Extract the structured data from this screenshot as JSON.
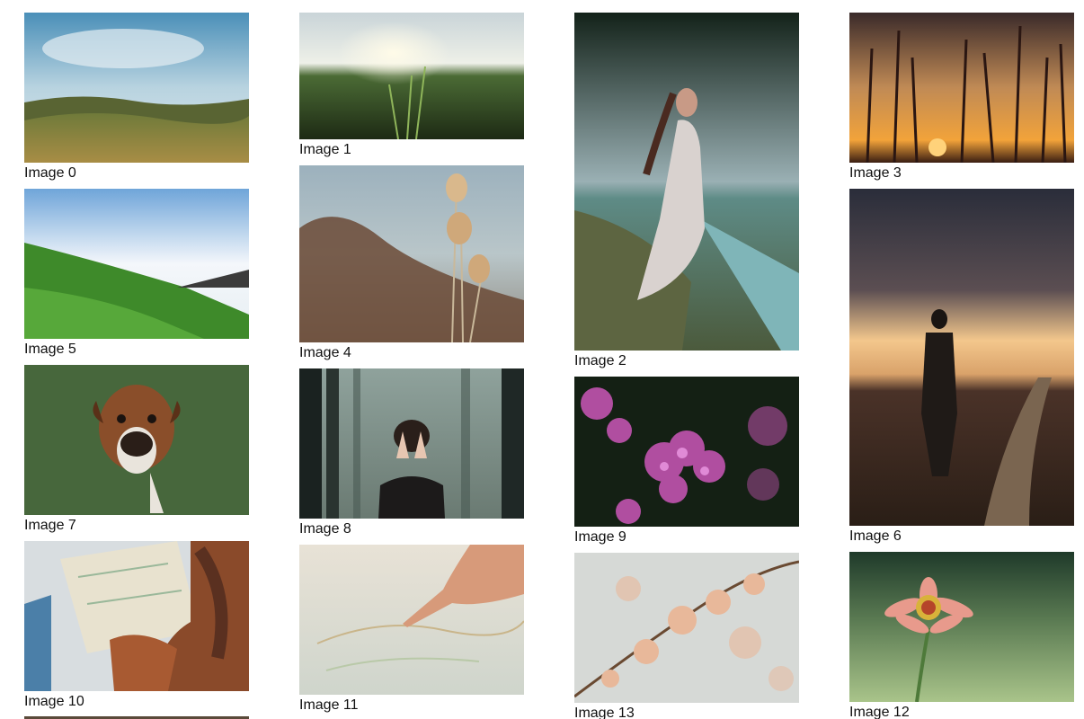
{
  "gallery": {
    "items": [
      {
        "caption": "Image 0"
      },
      {
        "caption": "Image 1"
      },
      {
        "caption": "Image 2"
      },
      {
        "caption": "Image 3"
      },
      {
        "caption": "Image 4"
      },
      {
        "caption": "Image 5"
      },
      {
        "caption": "Image 6"
      },
      {
        "caption": "Image 7"
      },
      {
        "caption": "Image 8"
      },
      {
        "caption": "Image 9"
      },
      {
        "caption": "Image 10"
      },
      {
        "caption": "Image 11"
      },
      {
        "caption": "Image 12"
      },
      {
        "caption": "Image 13"
      }
    ]
  }
}
